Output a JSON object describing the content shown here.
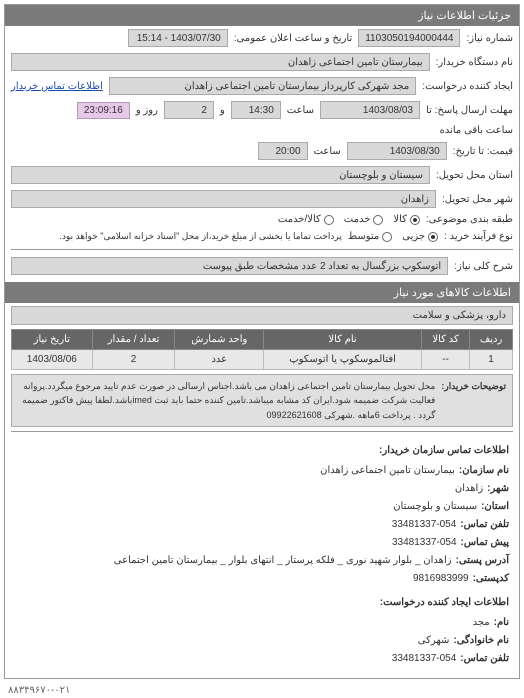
{
  "header": "جزئیات اطلاعات نیاز",
  "fields": {
    "request_no_label": "شماره نیاز:",
    "request_no": "1103050194000444",
    "public_datetime_label": "تاریخ و ساعت اعلان عمومی:",
    "public_datetime": "1403/07/30 - 15:14",
    "buyer_org_label": "نام دستگاه خریدار:",
    "buyer_org": "بیمارستان تامین اجتماعی زاهدان",
    "requester_label": "ایجاد کننده درخواست:",
    "requester": "مجد شهرکی کارپرداز بیمارستان تامین اجتماعی زاهدان",
    "contact_link": "اطلاعات تماس خریدار",
    "deadline_label": "مهلت ارسال پاسخ: تا",
    "deadline_date": "1403/08/03",
    "deadline_time_label": "ساعت",
    "deadline_time": "14:30",
    "days_label": "و",
    "days_value": "2",
    "days_suffix": "روز و",
    "remaining": "23:09:16",
    "remaining_suffix": "ساعت باقی مانده",
    "price_date_label": "قیمت: تا تاریخ:",
    "price_date": "1403/08/30",
    "price_time_label": "ساعت",
    "price_time": "20:00",
    "delivery_province_label": "استان محل تحویل:",
    "delivery_province": "سیستان و بلوچستان",
    "delivery_city_label": "شهر محل تحویل:",
    "delivery_city": "زاهدان",
    "priority_label": "طبقه بندی موضوعی:",
    "opt_goods": "کالا",
    "opt_service": "خدمت",
    "opt_both": "کالا/خدمت",
    "process_label": "نوع فرآیند خرید :",
    "opt_minor": "جزیی",
    "opt_medium": "متوسط",
    "process_note": "پرداخت تماما یا بخشی از مبلغ خرید،از محل \"اسناد خزانه اسلامی\" خواهد بود.",
    "subject_label": "شرح کلی نیاز:",
    "subject": "اتوسکوپ بزرگسال به تعداد 2 عدد مشخصات طبق پیوست"
  },
  "items_section_title": "اطلاعات کالاهای مورد نیاز",
  "category_box": "دارو، پزشکی و سلامت",
  "table": {
    "headers": [
      "ردیف",
      "کد کالا",
      "نام کالا",
      "واحد شمارش",
      "تعداد / مقدار",
      "تاریخ نیاز"
    ],
    "rows": [
      [
        "1",
        "--",
        "افتالموسکوپ یا اتوسکوپ",
        "عدد",
        "2",
        "1403/08/06"
      ]
    ]
  },
  "notes": {
    "label": "توضیحات خریدار:",
    "text": "محل تحویل بیمارستان تامین اجتماعی زاهدان می باشد.اجناس ارسالی در صورت عدم تایید مرجوع میگردد.پروانه فعالیت شرکت ضمیمه شود.ایران کد مشابه میباشد.تامین کننده حتما باید ثبت imedباشد.لطفا پیش فاکتور ضمیمه گردد . پرداخت 6ماهه .شهرکی 09922621608"
  },
  "contact": {
    "title": "اطلاعات تماس سازمان خریدار:",
    "org_label": "نام سازمان:",
    "org": "بیمارستان تامین اجتماعی زاهدان",
    "city_label": "شهر:",
    "city": "زاهدان",
    "province_label": "استان:",
    "province": "سیستان و بلوچستان",
    "phone_label": "تلفن تماس:",
    "phone": "33481337-054",
    "fax_label": "پیش تماس:",
    "fax": "33481337-054",
    "address_label": "آدرس پستی:",
    "address": "زاهدان _ بلوار شهید نوری _ فلکه پرستار _ انتهای بلوار _ بیمارستان تامین اجتماعی",
    "zip_label": "کدپستی:",
    "zip": "9816983999"
  },
  "creator": {
    "title": "اطلاعات ایجاد کننده درخواست:",
    "name_label": "نام:",
    "name": "مجد",
    "family_label": "نام خانوادگی:",
    "family": "شهرکی",
    "phone_label": "تلفن تماس:",
    "phone": "33481337-054"
  },
  "footer_phone": "۸۸۳۴۹۶۷۰-۰۲۱"
}
